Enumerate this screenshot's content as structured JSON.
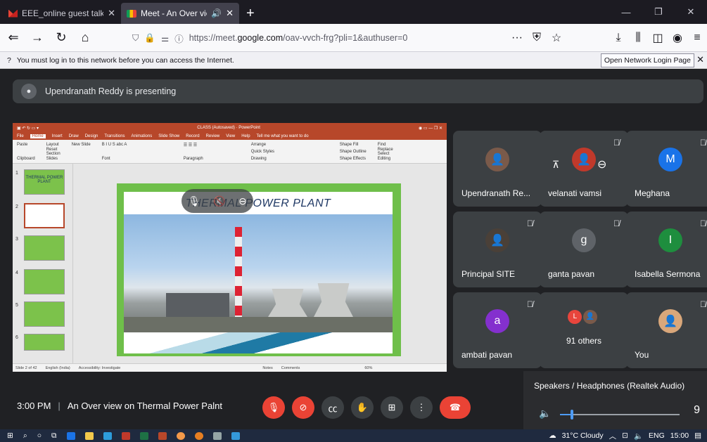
{
  "browser": {
    "tabs": [
      {
        "title": "EEE_online guest talk brochure",
        "icon": "gmail-icon",
        "active": false
      },
      {
        "title": "Meet - An Over view on The",
        "icon": "meet-icon",
        "active": true
      }
    ],
    "url_prefix": "https://meet.",
    "url_domain": "google.com",
    "url_suffix": "/oav-vvch-frg?pli=1&authuser=0",
    "notification": "You must log in to this network before you can access the Internet.",
    "notification_button": "Open Network Login Page"
  },
  "meet": {
    "presenting": "Upendranath Reddy is presenting",
    "presentation": {
      "window_title": "CLASS (Autosaved) · PowerPoint",
      "menu": [
        "File",
        "Home",
        "Insert",
        "Draw",
        "Design",
        "Transitions",
        "Animations",
        "Slide Show",
        "Record",
        "Review",
        "View",
        "Help"
      ],
      "tellme": "Tell me what you want to do",
      "ribbon_groups": [
        "Clipboard",
        "Slides",
        "Font",
        "Paragraph",
        "Drawing",
        "Editing"
      ],
      "ribbon_buttons": {
        "paste": "Paste",
        "new_slide": "New Slide",
        "layout": "Layout",
        "reset": "Reset",
        "section": "Section",
        "arrange": "Arrange",
        "quick_styles": "Quick Styles",
        "shape_fill": "Shape Fill",
        "shape_outline": "Shape Outline",
        "shape_effects": "Shape Effects",
        "find": "Find",
        "replace": "Replace",
        "select": "Select"
      },
      "slide_title": "THERMAL POWER PLANT",
      "thumb_numbers": [
        "1",
        "2",
        "3",
        "4",
        "5",
        "6"
      ],
      "thumb1_text": "THERMAL POWER PLANT",
      "status": {
        "slide": "Slide 2 of 42",
        "language": "English (India)",
        "accessibility": "Accessibility: Investigate",
        "notes": "Notes",
        "comments": "Comments",
        "zoom": "60%"
      }
    },
    "participants": [
      {
        "name": "Upendranath Re...",
        "avatar": "photo",
        "muted": false
      },
      {
        "name": "velanati vamsi",
        "avatar": "photo",
        "muted": true
      },
      {
        "name": "Meghana",
        "avatar": "M",
        "color": "#1a73e8",
        "muted": true
      },
      {
        "name": "Principal SITE",
        "avatar": "photo",
        "muted": true
      },
      {
        "name": "ganta pavan",
        "avatar": "g",
        "color": "#5f6368",
        "muted": true
      },
      {
        "name": "Isabella Sermona",
        "avatar": "I",
        "color": "#1e8e3e",
        "muted": true
      },
      {
        "name": "ambati pavan",
        "avatar": "a",
        "color": "#8430ce",
        "muted": true
      },
      {
        "name": "91 others",
        "avatar": "L",
        "color": "#e8453c",
        "muted": false
      },
      {
        "name": "You",
        "avatar": "photo",
        "muted": true
      }
    ],
    "audio": {
      "label": "Speakers / Headphones (Realtek Audio)",
      "volume_value": "9",
      "volume_fraction": 0.1
    },
    "time": "3:00 PM",
    "meeting_title": "An Over view on Thermal Power Palnt",
    "separator": "|"
  },
  "taskbar": {
    "weather": "31°C Cloudy",
    "lang": "ENG",
    "clock": "15:00"
  }
}
